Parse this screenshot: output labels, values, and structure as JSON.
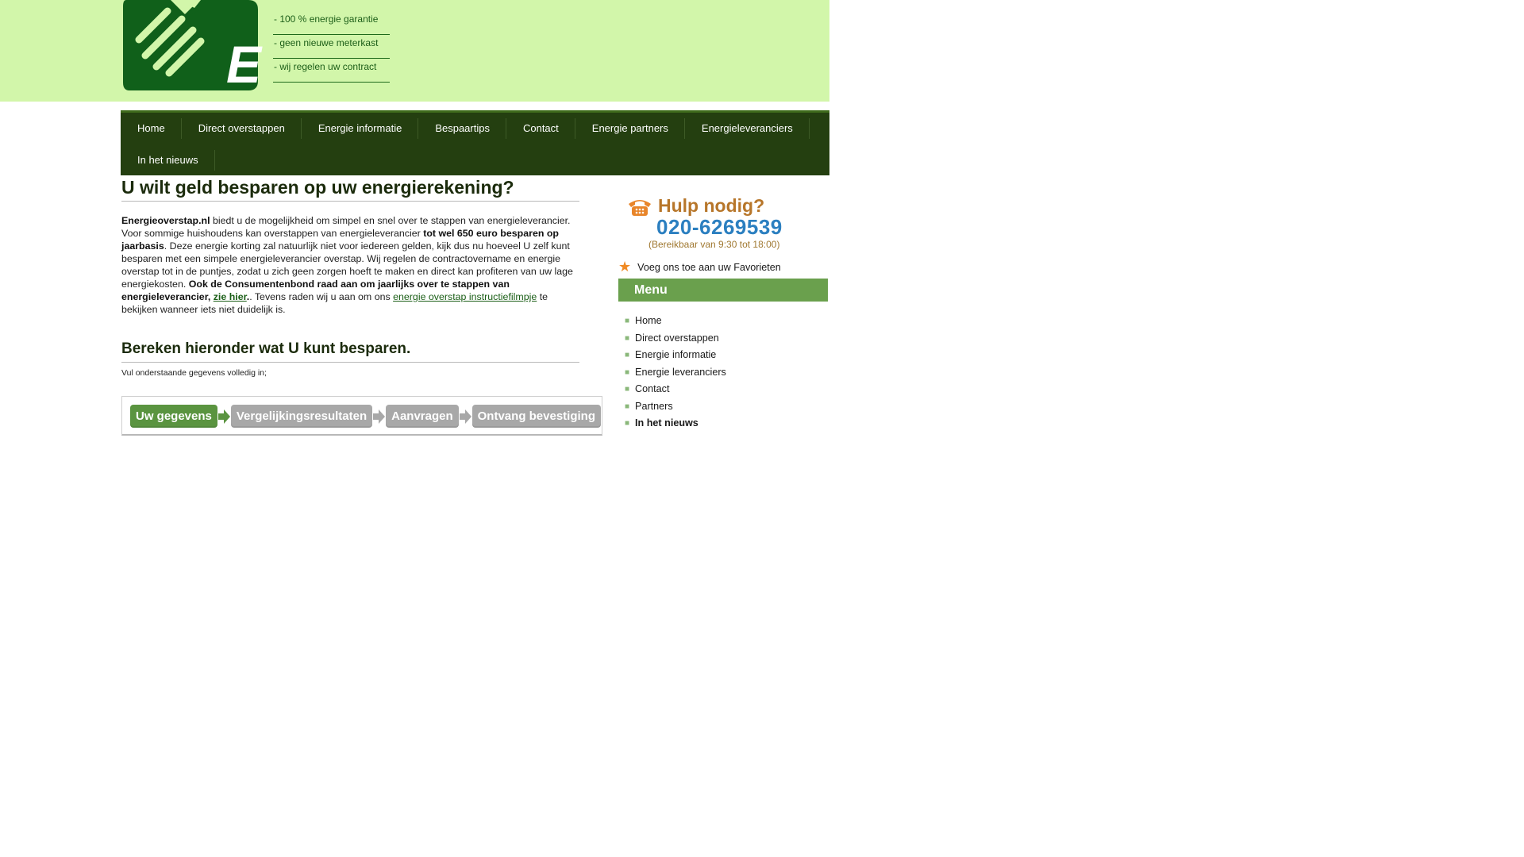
{
  "header": {
    "slogans": [
      "- 100 % energie garantie",
      "- geen nieuwe meterkast",
      "- wij regelen uw contract"
    ]
  },
  "nav": {
    "row1": [
      "Home",
      "Direct overstappen",
      "Energie informatie",
      "Bespaartips",
      "Contact",
      "Energie partners",
      "Energieleveranciers"
    ],
    "row2": [
      "In het nieuws"
    ]
  },
  "main": {
    "heading": "U wilt geld besparen op uw energierekening?",
    "intro": {
      "brand": "Energieoverstap.nl",
      "t1": " biedt u de mogelijkheid om simpel en snel over te stappen van energieleverancier. Voor sommige huishoudens kan overstappen van energieleverancier ",
      "bold1": "tot wel 650 euro besparen op jaarbasis",
      "t2": ". Deze energie korting zal natuurlijk niet voor iedereen gelden, kijk dus nu hoeveel U zelf kunt besparen met een simpele energieleverancier overstap. Wij regelen de contractovername en energie overstap tot in de puntjes, zodat u zich geen zorgen hoeft te maken en direct kan profiteren van uw lage energiekosten. ",
      "bold2": "Ook de Consumentenbond raad aan om jaarlijks over te stappen van energieleverancier, ",
      "link1": "zie hier",
      "t3": ". Tevens raden wij u aan om ons ",
      "link2": "energie overstap instructiefilmpje",
      "t4": " te bekijken wanneer iets niet duidelijk is."
    },
    "calc_heading": "Bereken hieronder wat U kunt besparen.",
    "calc_sub": "Vul onderstaande gegevens volledig in;",
    "steps": [
      "Uw gegevens",
      "Vergelijkingsresultaten",
      "Aanvragen",
      "Ontvang bevestiging"
    ]
  },
  "sidebar": {
    "help_title": "Hulp nodig?",
    "phone": "020-6269539",
    "hours": "(Bereikbaar van 9:30 tot 18:00)",
    "favorites": "Voeg ons toe aan uw Favorieten",
    "menu_title": "Menu",
    "menu": [
      "Home",
      "Direct overstappen",
      "Energie informatie",
      "Energie leveranciers",
      "Contact",
      "Partners",
      "In het nieuws"
    ]
  },
  "colors": {
    "header_bg": "#d2f6aa",
    "nav_bg": "#243f10",
    "menu_head": "#6aa04d",
    "step_active": "#5a9440",
    "step_inactive": "#a8a8a8",
    "phone": "#2b7fc0",
    "help_title": "#b7762a"
  }
}
